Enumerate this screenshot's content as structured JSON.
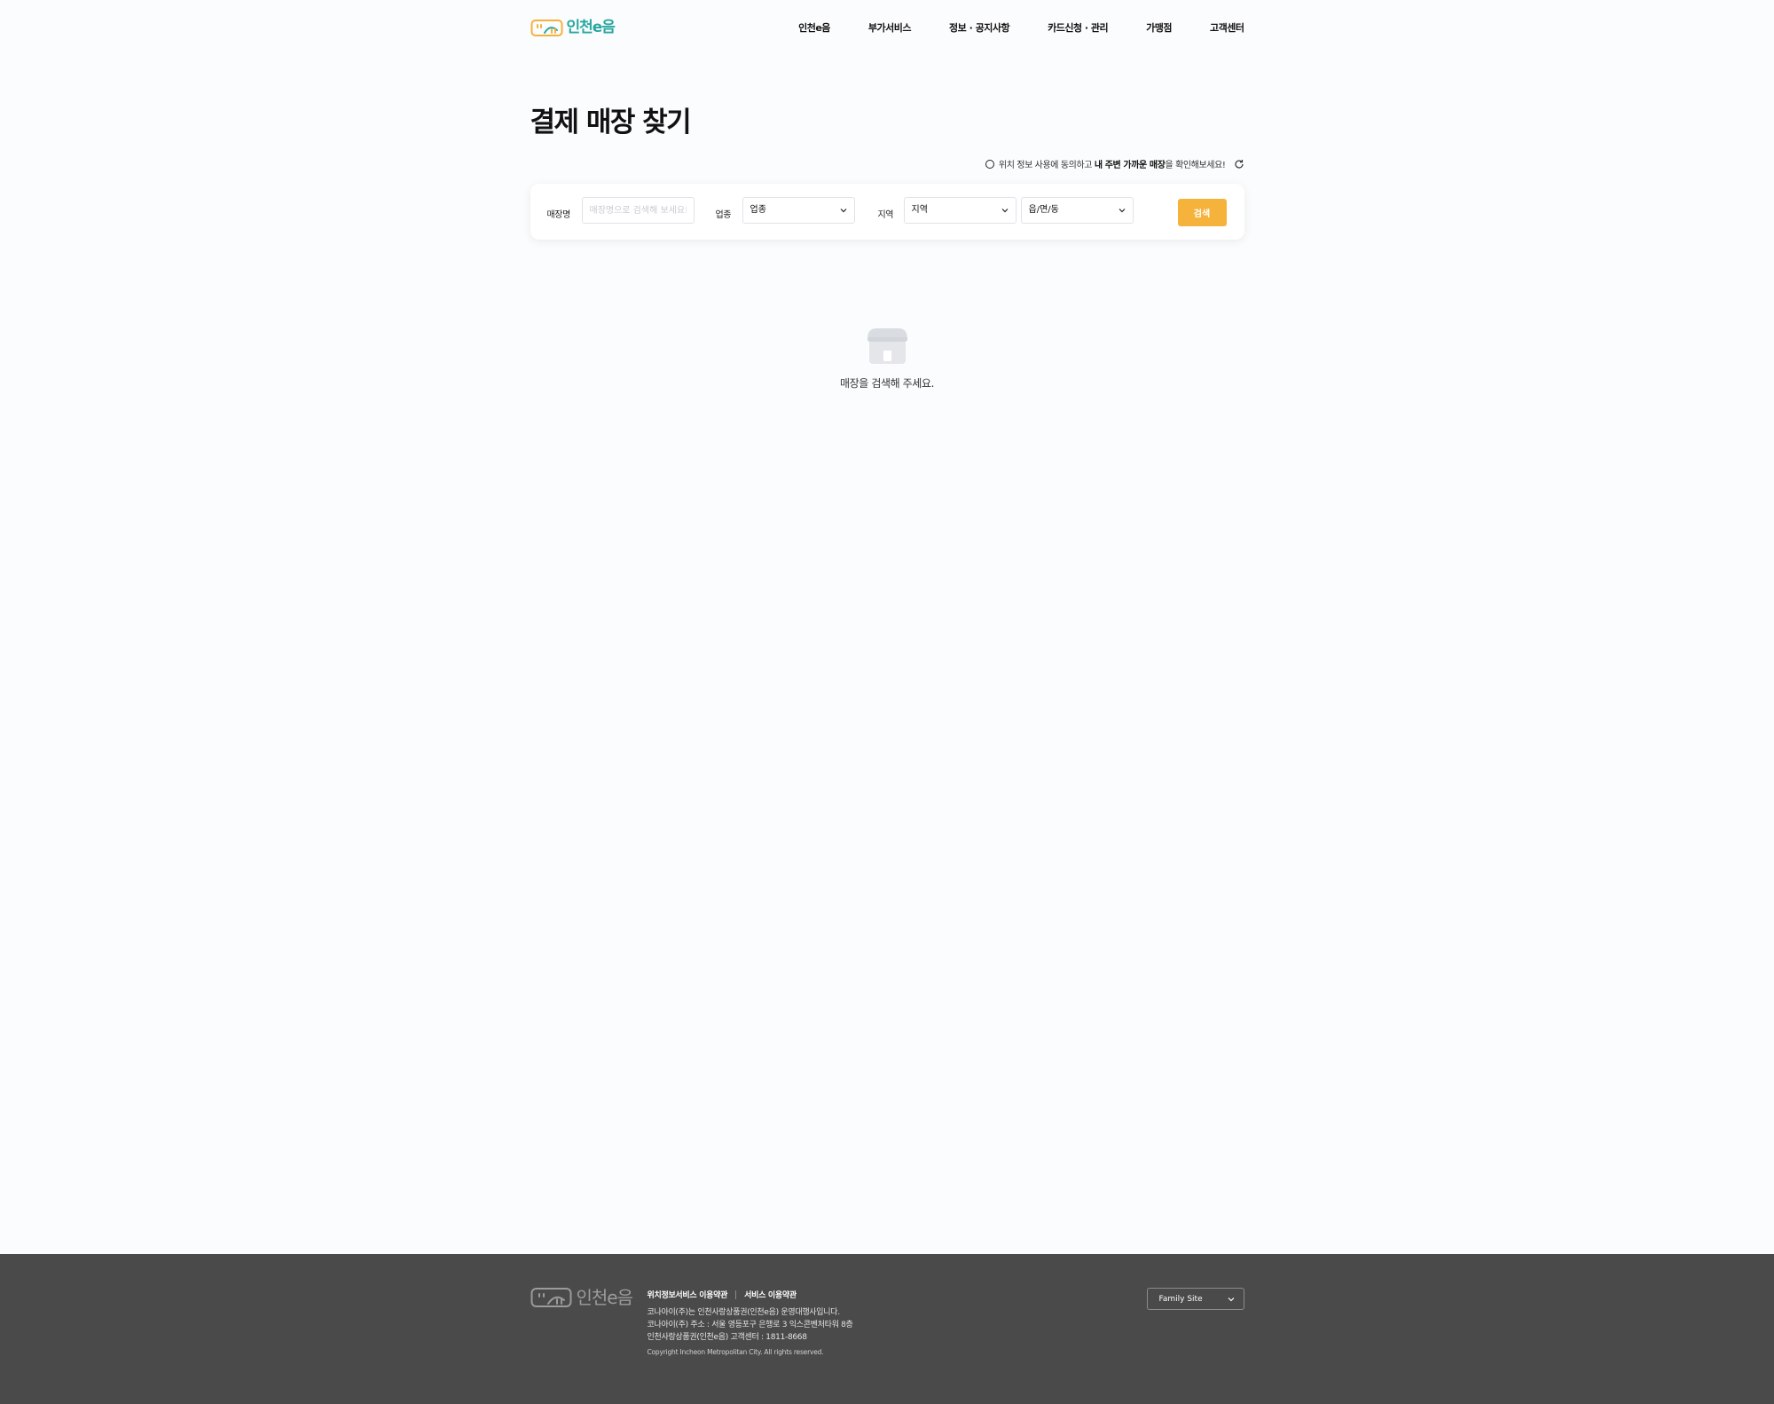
{
  "header": {
    "logo_text": "인천e음",
    "nav": [
      "인천e음",
      "부가서비스",
      "정보 · 공지사항",
      "카드신청 · 관리",
      "가맹점",
      "고객센터"
    ]
  },
  "page": {
    "title": "결제 매장 찾기"
  },
  "location": {
    "text_before": "위치 정보 사용에 동의하고",
    "text_bold": "내 주변 가까운 매장",
    "text_after": "을 확인해보세요!"
  },
  "search": {
    "store_label": "매장명",
    "store_placeholder": "매장명으로 검색해 보세요!",
    "category_label": "업종",
    "category_value": "업종",
    "region_label": "지역",
    "region_value": "지역",
    "town_value": "읍/면/동",
    "button_label": "검색"
  },
  "empty_state": {
    "message": "매장을 검색해 주세요."
  },
  "footer": {
    "logo_text": "인천e음",
    "links": [
      "위치정보서비스 이용약관",
      "서비스 이용약관"
    ],
    "info_lines": [
      "코나아이(주)는 인천사랑상품권(인천e음) 운영대행사입니다.",
      "코나아이(주) 주소 : 서울 영등포구 은행로 3 익스콘벤처타워 8층",
      "인천사랑상품권(인천e음) 고객센터 : 1811-8668"
    ],
    "copyright": "Copyright Incheon Metropolitan City. All rights reserved.",
    "family_site": "Family Site"
  },
  "colors": {
    "accent": "#f5b33c",
    "teal": "#2aa8a0",
    "footer_bg": "#4a4a4a",
    "page_bg": "#fbfcfd"
  }
}
